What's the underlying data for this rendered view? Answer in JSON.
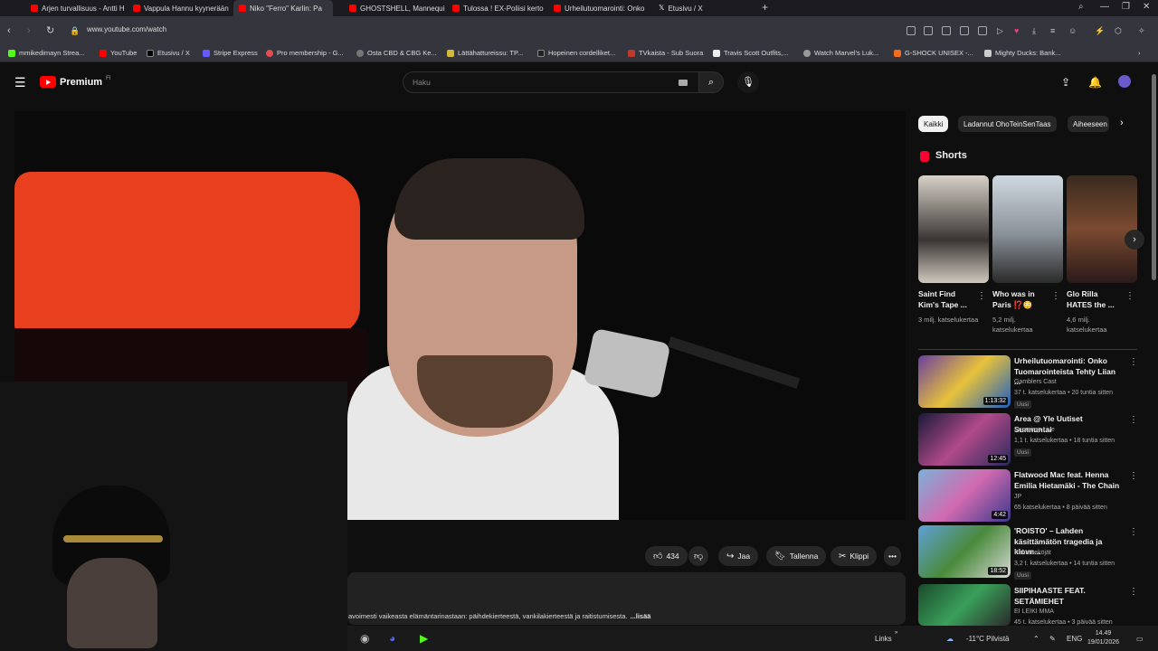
{
  "browser": {
    "tabs": [
      {
        "label": "Arjen turvallisuus - Antti H",
        "icon": "youtube-icon"
      },
      {
        "label": "Vappula Hannu kyynerään",
        "icon": "youtube-icon"
      },
      {
        "label": "Niko \"Ferro\" Karlin: Pa",
        "icon": "youtube-icon"
      },
      {
        "label": "GHOSTSHELL, Mannequin",
        "icon": "youtube-icon"
      },
      {
        "label": "Tulossa ! EX-Poliisi kerto",
        "icon": "youtube-icon"
      },
      {
        "label": "Urheilutuomarointi: Onko",
        "icon": "youtube-icon"
      },
      {
        "label": "Etusivu / X",
        "icon": "x-icon"
      }
    ],
    "url": "www.youtube.com/watch",
    "bookmarks": [
      "mmikedimayn Strea...",
      "YouTube",
      "Etusivu / X",
      "Stripe Express",
      "Pro membership - G...",
      "Osta CBD & CBG Ke...",
      "Lättähattureissu: TP...",
      "Hopeinen cordelliket...",
      "TVkaista - Sub Suora",
      "Travis Scott Outfits,...",
      "Watch Marvel's Luk...",
      "G-SHOCK UNISEX -...",
      "Mighty Ducks: Bank..."
    ]
  },
  "youtube": {
    "logo_text": "Premium",
    "logo_region": "FI",
    "search_placeholder": "Haku",
    "actions": {
      "likes": "434",
      "share": "Jaa",
      "save": "Tallenna",
      "clip": "Klippi"
    },
    "description": "avoimesti vaikeasta elämäntarinastaan: päihdekierteestä, vankilakierteestä ja raitistumisesta.",
    "description_more": "...lisää",
    "chips": [
      "Kaikki",
      "Ladannut OhoTeinSenTaas",
      "Aiheeseen"
    ],
    "shorts_heading": "Shorts",
    "shorts": [
      {
        "title": "Saint Find Kim's Tape ...",
        "views": "3 milj. katselukertaa"
      },
      {
        "title": "Who was in Paris ⁉️😳",
        "views": "5,2 milj. katselukertaa"
      },
      {
        "title": "Glo Rilla HATES the ...",
        "views": "4,6 milj. katselukertaa"
      }
    ],
    "recommendations": [
      {
        "title": "Urheilutuomarointi: Onko Tuomarointeista Tehty Liian ...",
        "channel": "Gamblers Cast",
        "meta": "37 t. katselukertaa • 20 tuntia sitten",
        "badge": "Uusi",
        "duration": "1:13:32"
      },
      {
        "title": "Area @ Yle Uutiset Sunnuntai",
        "channel": "Suomirap Live",
        "meta": "1,1 t. katselukertaa • 18 tuntia sitten",
        "badge": "Uusi",
        "duration": "12:45"
      },
      {
        "title": "Flatwood Mac feat. Henna Emilia Hietamäki - The Chain",
        "channel": "JP",
        "meta": "65 katselukertaa • 8 päivää sitten",
        "badge": "",
        "duration": "4:42"
      },
      {
        "title": "'ROISTO' – Lahden käsittämätön tragedia ja klovn...",
        "channel": "Pahanteköjät",
        "meta": "3,2 t. katselukertaa • 14 tuntia sitten",
        "badge": "Uusi",
        "duration": "18:52"
      },
      {
        "title": "SIIPIHAASTE FEAT. SETÄMIEHET",
        "channel": "EI LEIKI MMA",
        "meta": "45 t. katselukertaa • 3 päivää sitten",
        "badge": "",
        "duration": ""
      }
    ]
  },
  "taskbar": {
    "links_label": "Links",
    "weather": "-11°C  Pilvistä",
    "lang": "ENG",
    "time": "14.49",
    "date": "19/01/2026"
  }
}
